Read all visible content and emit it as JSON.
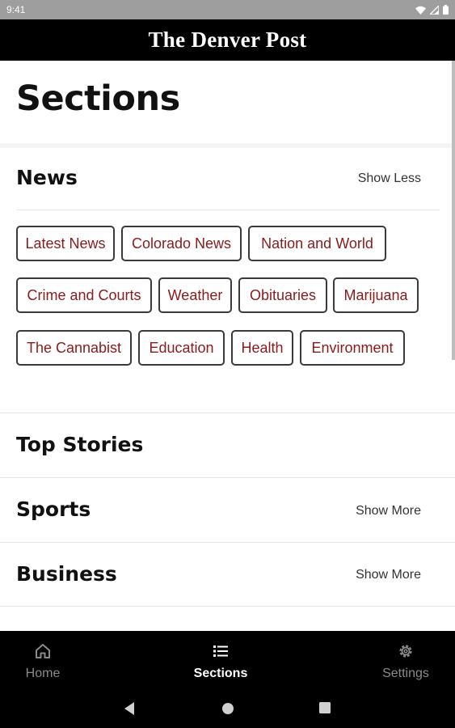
{
  "status_bar": {
    "time": "9:41"
  },
  "header": {
    "masthead": "The Denver Post"
  },
  "page": {
    "title": "Sections"
  },
  "sections": {
    "news": {
      "title": "News",
      "toggle": "Show Less",
      "tags": [
        "Latest News",
        "Colorado News",
        "Nation and World",
        "Crime and Courts",
        "Weather",
        "Obituaries",
        "Marijuana",
        "The Cannabist",
        "Education",
        "Health",
        "Environment"
      ]
    },
    "top_stories": {
      "title": "Top Stories"
    },
    "sports": {
      "title": "Sports",
      "toggle": "Show More"
    },
    "business": {
      "title": "Business",
      "toggle": "Show More"
    }
  },
  "bottom_nav": {
    "items": [
      {
        "label": "Home",
        "icon": "home-icon"
      },
      {
        "label": "Sections",
        "icon": "list-icon"
      },
      {
        "label": "Settings",
        "icon": "gear-icon"
      }
    ],
    "active": "Sections"
  },
  "colors": {
    "accent": "#8b1a1a",
    "header_bg": "#000000",
    "status_bg": "#9e9e9e"
  }
}
